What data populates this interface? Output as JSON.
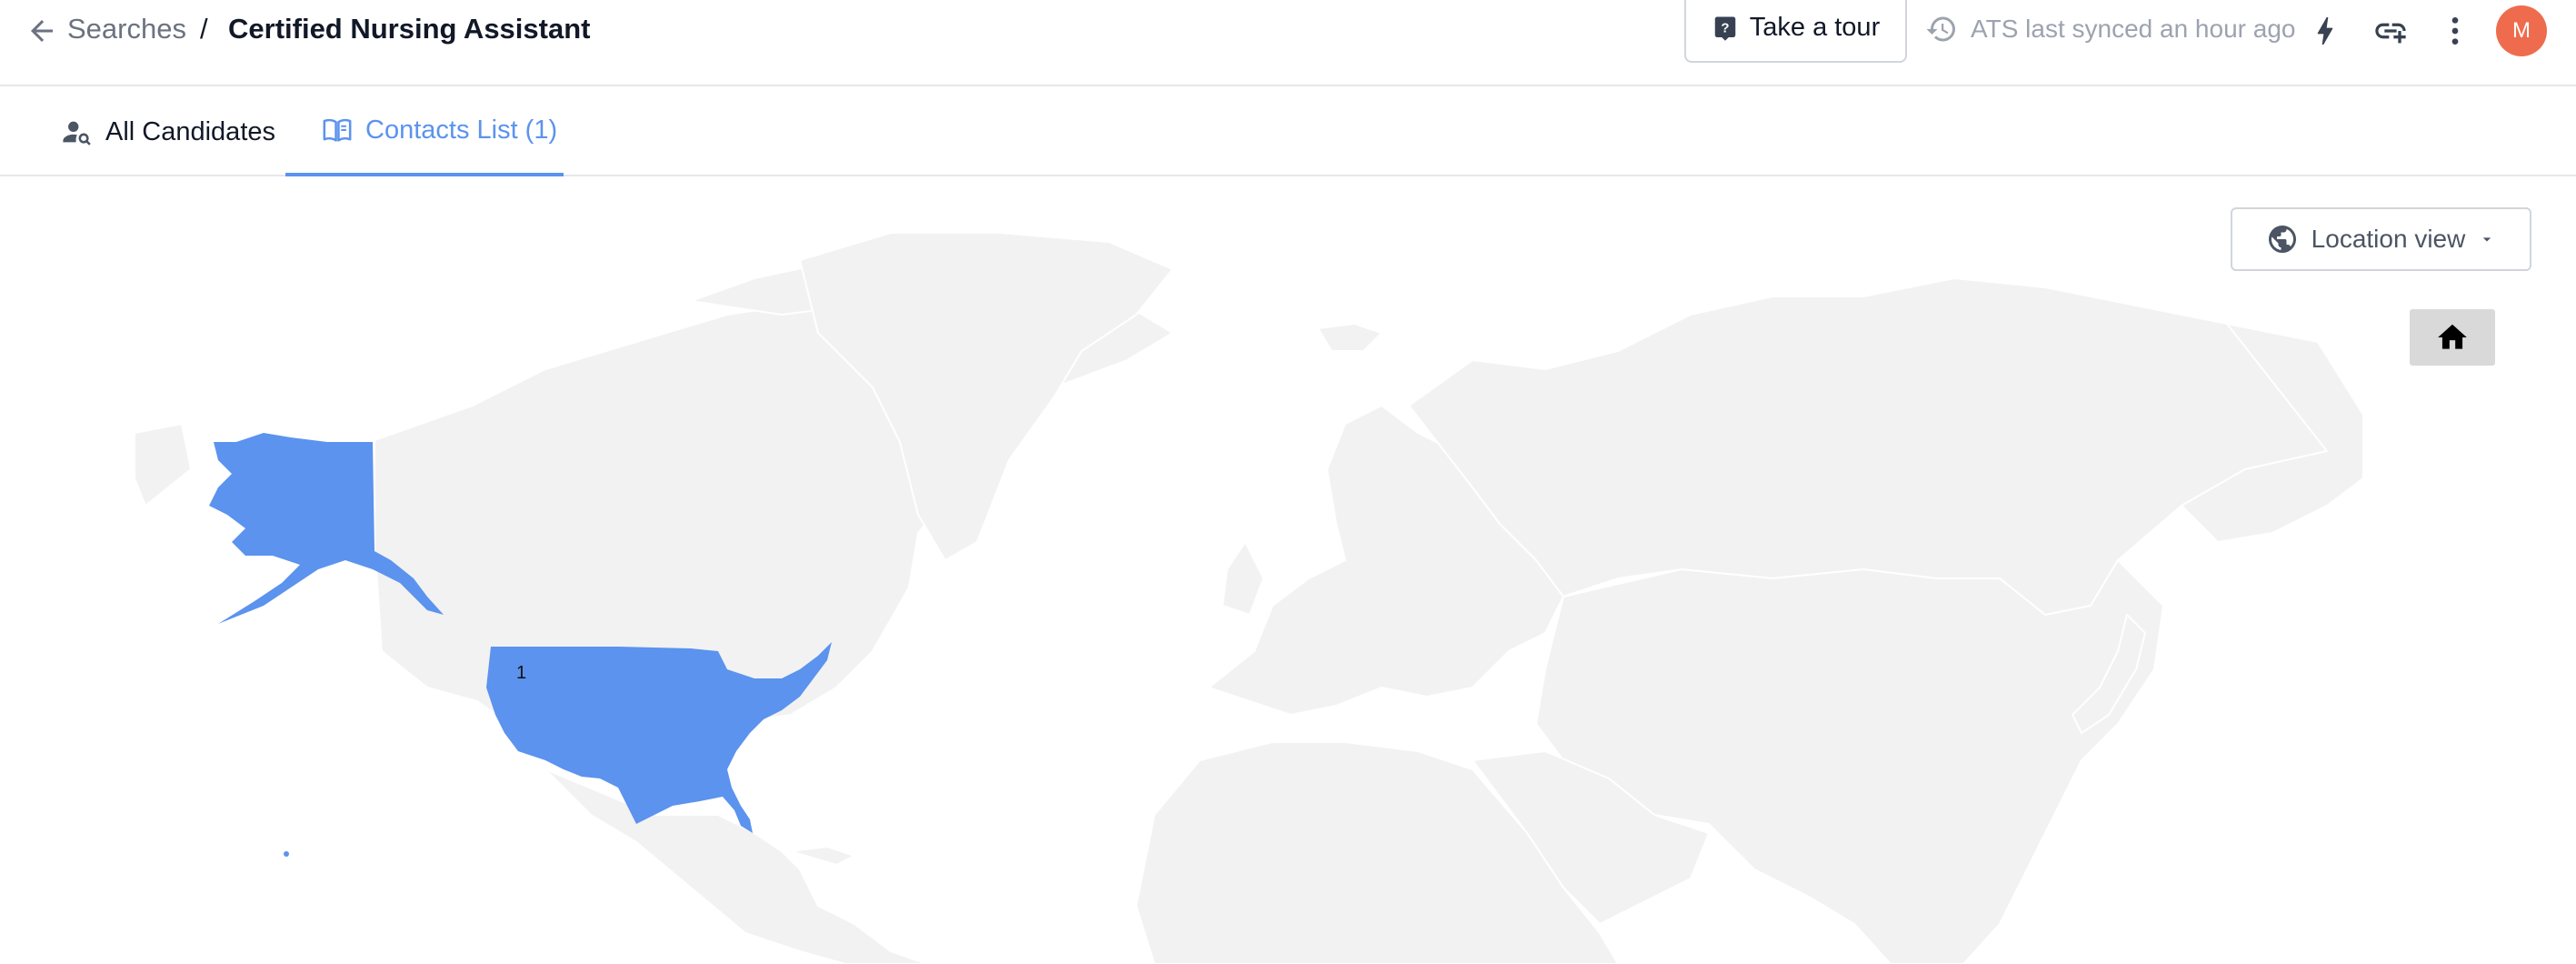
{
  "breadcrumb": {
    "parent_label": "Searches",
    "separator": "/",
    "current_title": "Certified Nursing Assistant"
  },
  "toolbar": {
    "tour_label": "Take a tour",
    "sync_status": "ATS last synced an hour ago",
    "icons": [
      "history-icon",
      "bolt-icon",
      "link-add-icon",
      "more-vert-icon"
    ],
    "avatar_initial": "M",
    "avatar_color": "#ee6c4d"
  },
  "tabs": [
    {
      "label": "All Candidates",
      "icon": "person-search-icon",
      "active": false
    },
    {
      "label": "Contacts List (1)",
      "icon": "open-book-icon",
      "active": true
    }
  ],
  "map": {
    "view_selector_label": "Location view",
    "view_selector_icon": "globe-icon",
    "home_button_icon": "home-icon",
    "highlighted_region": "United States",
    "highlighted_count": "1",
    "highlight_color": "#5b93ee",
    "land_color": "#f2f2f2",
    "accent_color": "#5b93ee"
  }
}
